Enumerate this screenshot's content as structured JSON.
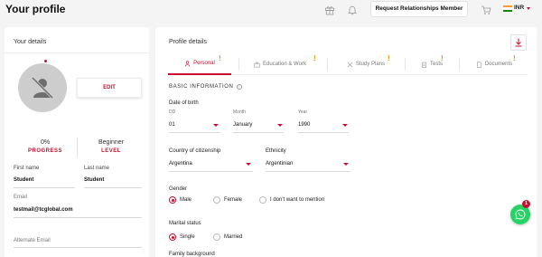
{
  "header": {
    "title": "Your profile",
    "request_button": "Request Relationships Member",
    "currency": "INR",
    "icons": [
      "gift-icon",
      "bell-icon",
      "cart-icon",
      "india-flag-icon"
    ]
  },
  "left_card": {
    "title": "Your details",
    "edit_label": "EDIT",
    "progress_value": "0%",
    "progress_label": "PROGRESS",
    "level_value": "Beginner",
    "level_label": "LEVEL",
    "first_name_label": "First name",
    "first_name_value": "Student",
    "last_name_label": "Last name",
    "last_name_value": "Student",
    "email_label": "Email",
    "email_value": "testmail@tcglobal.com",
    "alt_email_label": "Alternate Email",
    "alt_email_value": ""
  },
  "right_card": {
    "title": "Profile details",
    "tabs": [
      {
        "label": "Personal",
        "icon": "person-icon",
        "active": true,
        "warning": true
      },
      {
        "label": "Education & Work",
        "icon": "briefcase-icon",
        "active": false,
        "warning": true
      },
      {
        "label": "Study Plans",
        "icon": "tools-icon",
        "active": false,
        "warning": true
      },
      {
        "label": "Tests",
        "icon": "clipboard-icon",
        "active": false,
        "warning": true
      },
      {
        "label": "Documents",
        "icon": "document-icon",
        "active": false,
        "warning": true
      }
    ],
    "warning_mark": "!",
    "section_title": "BASIC INFORMATION",
    "dob_label": "Date of birth",
    "dd_label": "DD",
    "dd_value": "01",
    "month_label": "Month",
    "month_value": "January",
    "year_label": "Year",
    "year_value": "1990",
    "citizenship_label": "Country of citizenship",
    "citizenship_value": "Argentina",
    "ethnicity_label": "Ethnicity",
    "ethnicity_value": "Argentinian",
    "gender_label": "Gender",
    "gender_options": [
      {
        "label": "Male",
        "selected": true
      },
      {
        "label": "Female",
        "selected": false
      },
      {
        "label": "I don't want to mention",
        "selected": false
      }
    ],
    "marital_label": "Marital status",
    "marital_options": [
      {
        "label": "Single",
        "selected": true
      },
      {
        "label": "Married",
        "selected": false
      }
    ],
    "family_label": "Family background"
  },
  "whatsapp": {
    "badge": "1"
  },
  "colors": {
    "accent": "#c8102e",
    "warning": "#e69b00",
    "whatsapp": "#25d366"
  }
}
